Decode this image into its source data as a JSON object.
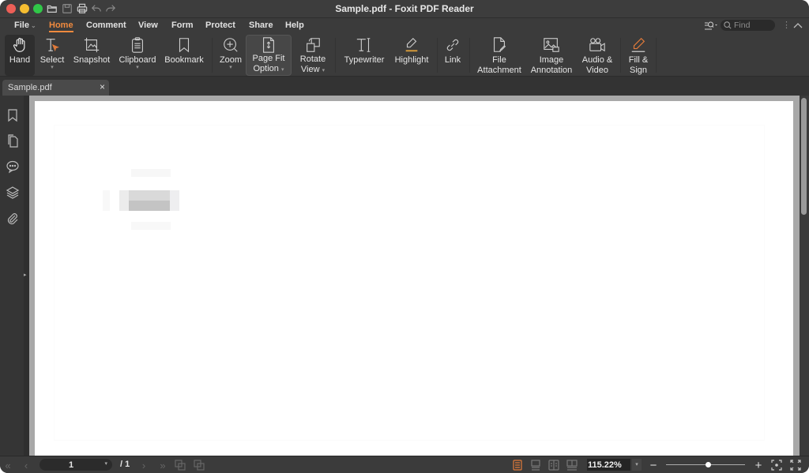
{
  "window": {
    "title": "Sample.pdf - Foxit PDF Reader"
  },
  "quick_access": [
    {
      "name": "open-icon"
    },
    {
      "name": "save-icon"
    },
    {
      "name": "print-icon"
    },
    {
      "name": "undo-icon"
    },
    {
      "name": "redo-icon"
    }
  ],
  "menu": {
    "items": [
      {
        "label": "File",
        "active": false
      },
      {
        "label": "Home",
        "active": true
      },
      {
        "label": "Comment",
        "active": false
      },
      {
        "label": "View",
        "active": false
      },
      {
        "label": "Form",
        "active": false
      },
      {
        "label": "Protect",
        "active": false
      },
      {
        "label": "Share",
        "active": false
      },
      {
        "label": "Help",
        "active": false
      }
    ],
    "find_placeholder": "Find"
  },
  "ribbon": {
    "buttons": [
      {
        "label": "Hand",
        "icon": "hand-icon",
        "selected": true
      },
      {
        "label": "Select",
        "icon": "select-text-icon",
        "dropdown": true
      },
      {
        "label": "Snapshot",
        "icon": "snapshot-icon"
      },
      {
        "label": "Clipboard",
        "icon": "clipboard-icon",
        "dropdown": true
      },
      {
        "label": "Bookmark",
        "icon": "bookmark-icon"
      },
      {
        "label": "Zoom",
        "icon": "zoom-in-icon",
        "dropdown": true
      },
      {
        "label": "Page Fit Option",
        "line1": "Page Fit",
        "line2": "Option",
        "icon": "page-fit-icon",
        "dropdown": true
      },
      {
        "label": "Rotate View",
        "line1": "Rotate",
        "line2": "View",
        "icon": "rotate-view-icon",
        "dropdown": true
      },
      {
        "label": "Typewriter",
        "icon": "typewriter-icon"
      },
      {
        "label": "Highlight",
        "icon": "highlight-icon"
      },
      {
        "label": "Link",
        "icon": "link-icon"
      },
      {
        "label": "File Attachment",
        "line1": "File",
        "line2": "Attachment",
        "icon": "file-attachment-icon"
      },
      {
        "label": "Image Annotation",
        "line1": "Image",
        "line2": "Annotation",
        "icon": "image-annotation-icon"
      },
      {
        "label": "Audio & Video",
        "line1": "Audio &",
        "line2": "Video",
        "icon": "audio-video-icon"
      },
      {
        "label": "Fill & Sign",
        "line1": "Fill &",
        "line2": "Sign",
        "icon": "fill-sign-icon"
      }
    ],
    "accent": "#f08a3e"
  },
  "tabs": [
    {
      "label": "Sample.pdf",
      "close": "×"
    }
  ],
  "left_panel": {
    "icons": [
      "bookmarks-panel-icon",
      "pages-panel-icon",
      "comments-panel-icon",
      "layers-panel-icon",
      "attachments-panel-icon"
    ],
    "expand_arrow": "▸"
  },
  "status": {
    "current_page": "1",
    "total_pages": "/ 1",
    "zoom_value": "115.22%",
    "zoom_slider_fraction": 0.53,
    "view_modes": [
      "single-page-icon",
      "continuous-icon",
      "facing-icon",
      "continuous-facing-icon"
    ],
    "active_view_mode": 0
  },
  "colors": {
    "accent": "#f08a3e",
    "chrome": "#3b3b3b",
    "page": "#ffffff"
  }
}
